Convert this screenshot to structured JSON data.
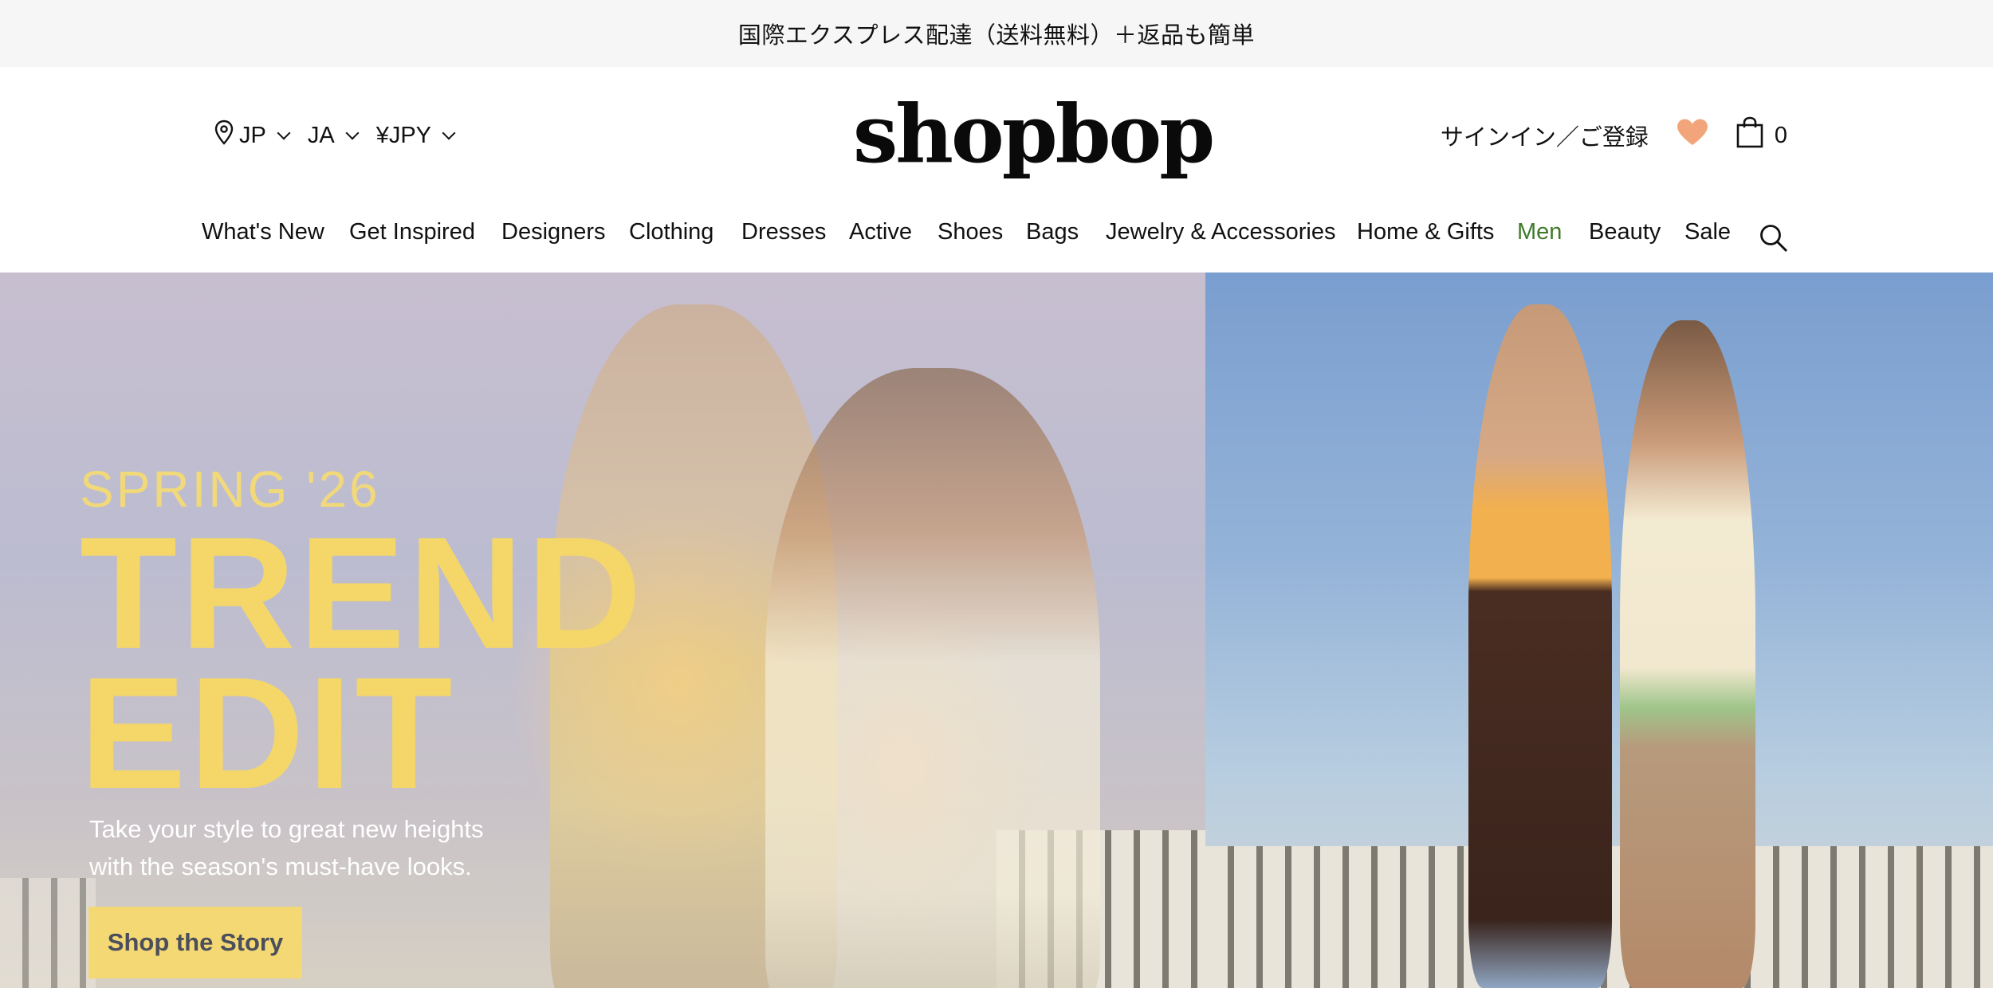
{
  "promo": {
    "text": "国際エクスプレス配達（送料無料）＋返品も簡単"
  },
  "locale": {
    "country": "JP",
    "language": "JA",
    "currency": "¥JPY"
  },
  "logo": {
    "text": "shopbop"
  },
  "account": {
    "signin_label": "サインイン／ご登録",
    "cart_count": "0"
  },
  "nav": {
    "items": [
      {
        "label": "What's New"
      },
      {
        "label": "Get Inspired"
      },
      {
        "label": "Designers"
      },
      {
        "label": "Clothing"
      },
      {
        "label": "Dresses"
      },
      {
        "label": "Active"
      },
      {
        "label": "Shoes"
      },
      {
        "label": "Bags"
      },
      {
        "label": "Jewelry & Accessories"
      },
      {
        "label": "Home & Gifts"
      },
      {
        "label": "Men"
      },
      {
        "label": "Beauty"
      },
      {
        "label": "Sale"
      }
    ]
  },
  "hero": {
    "eyebrow": "SPRING '26",
    "title_line1": "TREND",
    "title_line2": "EDIT",
    "subtitle_line1": "Take your style to great new heights",
    "subtitle_line2": "with the season's must-have looks.",
    "cta_label": "Shop the Story"
  },
  "colors": {
    "men_link": "#3f7a2a",
    "heart": "#f2a57a",
    "hero_headline": "#f4d768",
    "cta_background": "#f3d874"
  },
  "icons": [
    "location-pin-icon",
    "heart-icon",
    "shopping-bag-icon",
    "search-icon",
    "chevron-down-icon"
  ]
}
